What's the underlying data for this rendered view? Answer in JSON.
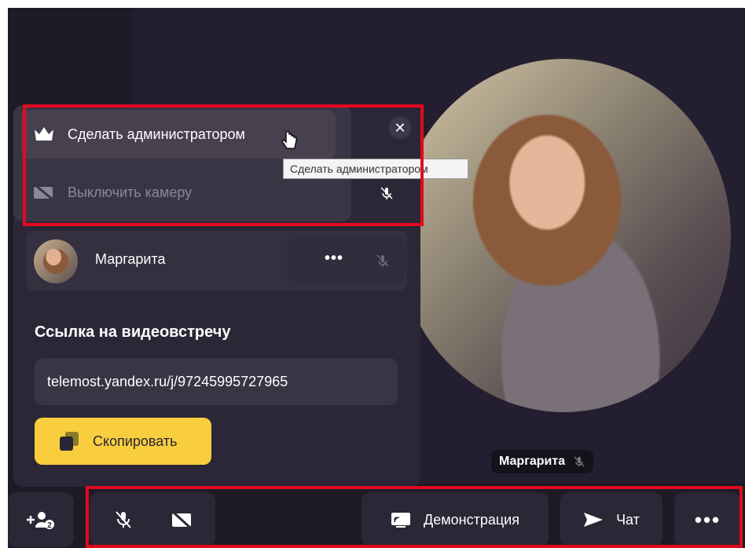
{
  "menu": {
    "make_admin_label": "Сделать администратором",
    "camera_off_label": "Выключить камеру",
    "close_glyph": "✕"
  },
  "tooltip": {
    "text": "Сделать администратором"
  },
  "participant": {
    "name": "Маргарита",
    "more_glyph": "•••"
  },
  "link": {
    "title": "Ссылка на видеовстречу",
    "url": "telemost.yandex.ru/j/97245995727965",
    "copy_label": "Скопировать"
  },
  "stage": {
    "name": "Маргарита"
  },
  "toolbar": {
    "invite_badge": "2",
    "demo_label": "Демонстрация",
    "chat_label": "Чат",
    "more_glyph": "•••"
  },
  "colors": {
    "accent": "#f8ce3f",
    "frame": "#e3091f",
    "background": "#1e1a26"
  }
}
